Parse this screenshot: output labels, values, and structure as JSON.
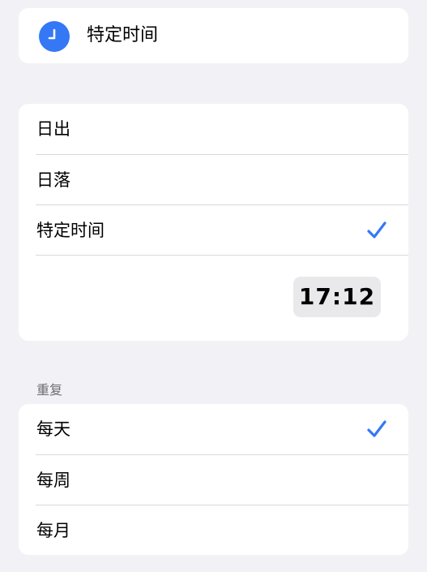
{
  "header": {
    "title": "特定时间",
    "icon": "clock-icon",
    "icon_color": "#3478f6"
  },
  "trigger": {
    "options": [
      {
        "label": "日出",
        "selected": false
      },
      {
        "label": "日落",
        "selected": false
      },
      {
        "label": "特定时间",
        "selected": true
      }
    ],
    "time": "17:12"
  },
  "repeat": {
    "section_title": "重复",
    "options": [
      {
        "label": "每天",
        "selected": true
      },
      {
        "label": "每周",
        "selected": false
      },
      {
        "label": "每月",
        "selected": false
      }
    ]
  },
  "colors": {
    "accent": "#3478f6",
    "background": "#f2f2f6",
    "card": "#ffffff"
  }
}
